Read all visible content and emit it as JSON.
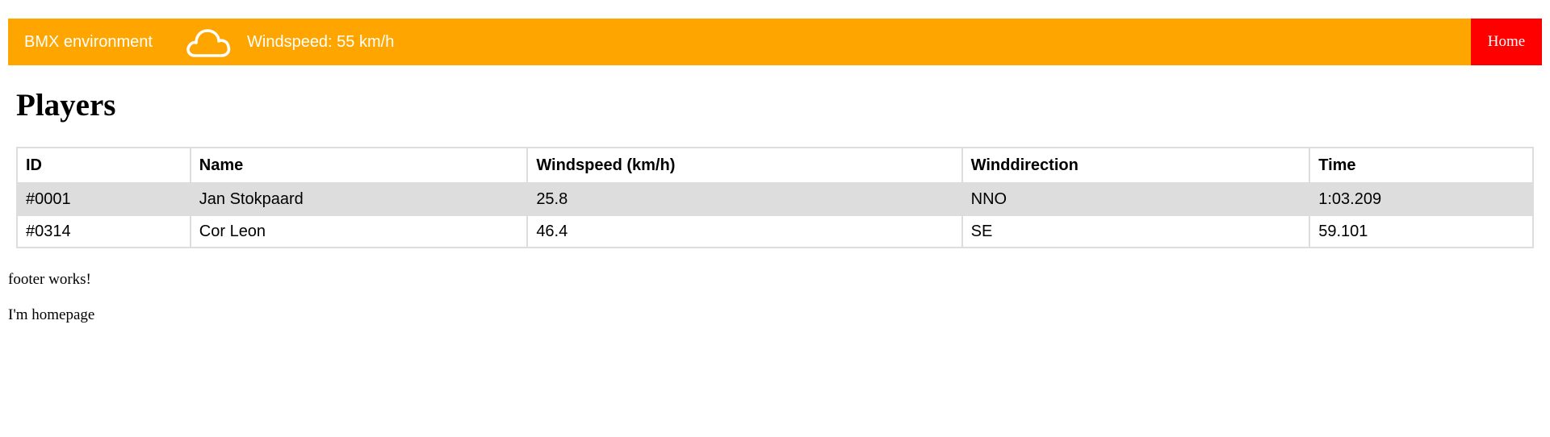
{
  "navbar": {
    "brand": "BMX environment",
    "weather_icon": "cloud-icon",
    "windspeed": "Windspeed: 55 km/h",
    "home_label": "Home",
    "colors": {
      "bar": "#ffa500",
      "home": "#ff0000",
      "text": "#ffffff"
    }
  },
  "page": {
    "title": "Players"
  },
  "table": {
    "headers": [
      "ID",
      "Name",
      "Windspeed (km/h)",
      "Winddirection",
      "Time"
    ],
    "rows": [
      [
        "#0001",
        "Jan Stokpaard",
        "25.8",
        "NNO",
        "1:03.209"
      ],
      [
        "#0314",
        "Cor Leon",
        "46.4",
        "SE",
        "59.101"
      ]
    ],
    "stripe_color": "#dddddd"
  },
  "footer": {
    "text": "footer works!"
  },
  "homepage": {
    "text": "I'm homepage"
  }
}
